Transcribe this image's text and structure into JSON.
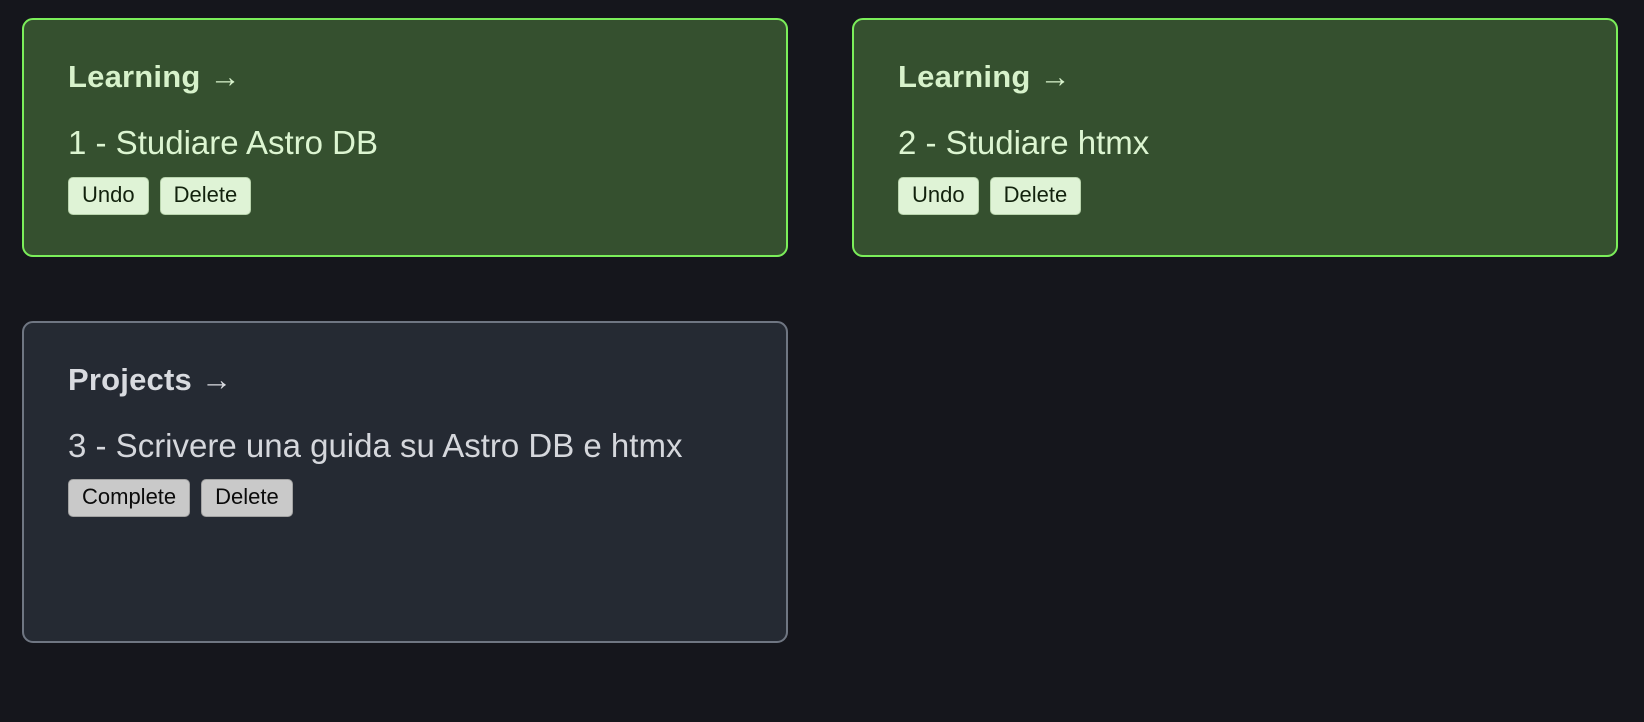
{
  "page": {
    "background_color": "#15161c"
  },
  "theme": {
    "done_card_bg": "#35502f",
    "done_card_border": "#7bee5a",
    "done_text": "#dcf5d1",
    "done_button_bg": "#dff3d6",
    "open_card_bg": "#252a33",
    "open_card_border": "#6f7682",
    "open_text": "#d5d7dc",
    "open_button_bg": "#c9c9c9"
  },
  "cards": [
    {
      "category": "Learning",
      "arrow": "→",
      "title": "1 - Studiare Astro DB",
      "state": "done",
      "buttons": [
        {
          "label": "Undo"
        },
        {
          "label": "Delete"
        }
      ]
    },
    {
      "category": "Learning",
      "arrow": "→",
      "title": "2 - Studiare htmx",
      "state": "done",
      "buttons": [
        {
          "label": "Undo"
        },
        {
          "label": "Delete"
        }
      ]
    },
    {
      "category": "Projects",
      "arrow": "→",
      "title": "3 - Scrivere una guida su Astro DB e htmx",
      "state": "open",
      "buttons": [
        {
          "label": "Complete"
        },
        {
          "label": "Delete"
        }
      ]
    }
  ]
}
